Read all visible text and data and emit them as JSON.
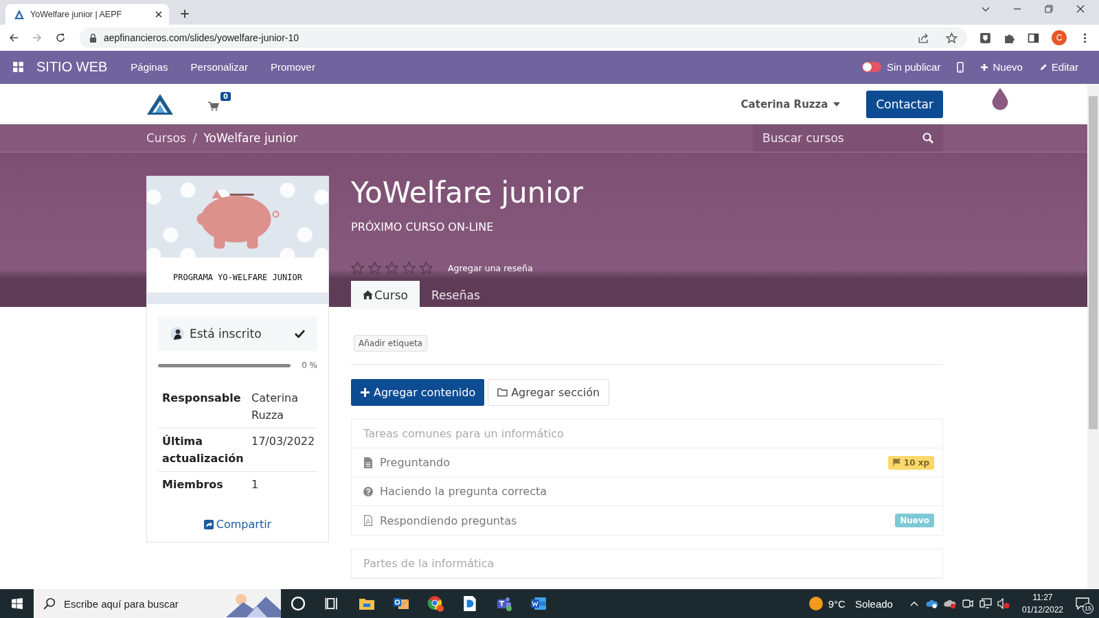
{
  "browser": {
    "tab_title": "YoWelfare junior | AEPF",
    "new_tab": "+",
    "url": "aepfinancieros.com/slides/yowelfare-junior-10",
    "profile_letter": "C"
  },
  "odoo_bar": {
    "brand": "SITIO WEB",
    "menu": [
      "Páginas",
      "Personalizar",
      "Promover"
    ],
    "publish": {
      "label": "Sin publicar",
      "on": false
    },
    "new": "Nuevo",
    "edit": "Editar"
  },
  "header": {
    "cart_count": "0",
    "user": "Caterina Ruzza",
    "contact": "Contactar"
  },
  "breadcrumb": {
    "items": [
      "Cursos",
      "YoWelfare junior"
    ],
    "separator": "/",
    "search_placeholder": "Buscar cursos"
  },
  "course": {
    "title": "YoWelfare junior",
    "subtitle": "PRÓXIMO CURSO ON-LINE",
    "stars": 0,
    "review_link": "Agregar una reseña",
    "tabs": [
      {
        "label": "Curso",
        "selected": true
      },
      {
        "label": "Reseñas",
        "selected": false
      }
    ],
    "cover_caption": "PROGRAMA YO-WELFARE JUNIOR"
  },
  "sidebar": {
    "enrolled": "Está inscrito",
    "level": 0,
    "progress_label": "0 %",
    "info": [
      {
        "label": "Responsable",
        "value": "Caterina Ruzza"
      },
      {
        "label": "Última actualización",
        "value": "17/03/2022"
      },
      {
        "label": "Miembros",
        "value": "1"
      }
    ],
    "share": "Compartir"
  },
  "tag_button": "Añadir etiqueta",
  "add_content": "Agregar contenido",
  "add_section": "Agregar sección",
  "sections": [
    {
      "title": "Tareas comunes para un informático",
      "items": [
        {
          "kind": "document",
          "title": "Preguntando",
          "badge": {
            "kind": "xp",
            "text": "10 xp"
          }
        },
        {
          "kind": "question",
          "title": "Haciendo la pregunta correcta"
        },
        {
          "kind": "pdf",
          "title": "Respondiendo preguntas",
          "badge": {
            "kind": "new",
            "text": "Nuevo"
          }
        }
      ]
    },
    {
      "title": "Partes de la informática"
    }
  ],
  "taskbar": {
    "search_placeholder": "Escribe aquí para buscar",
    "temperature": "9°C",
    "weather": "Soleado",
    "time": "11:27",
    "date": "01/12/2022",
    "notifications": "15"
  }
}
